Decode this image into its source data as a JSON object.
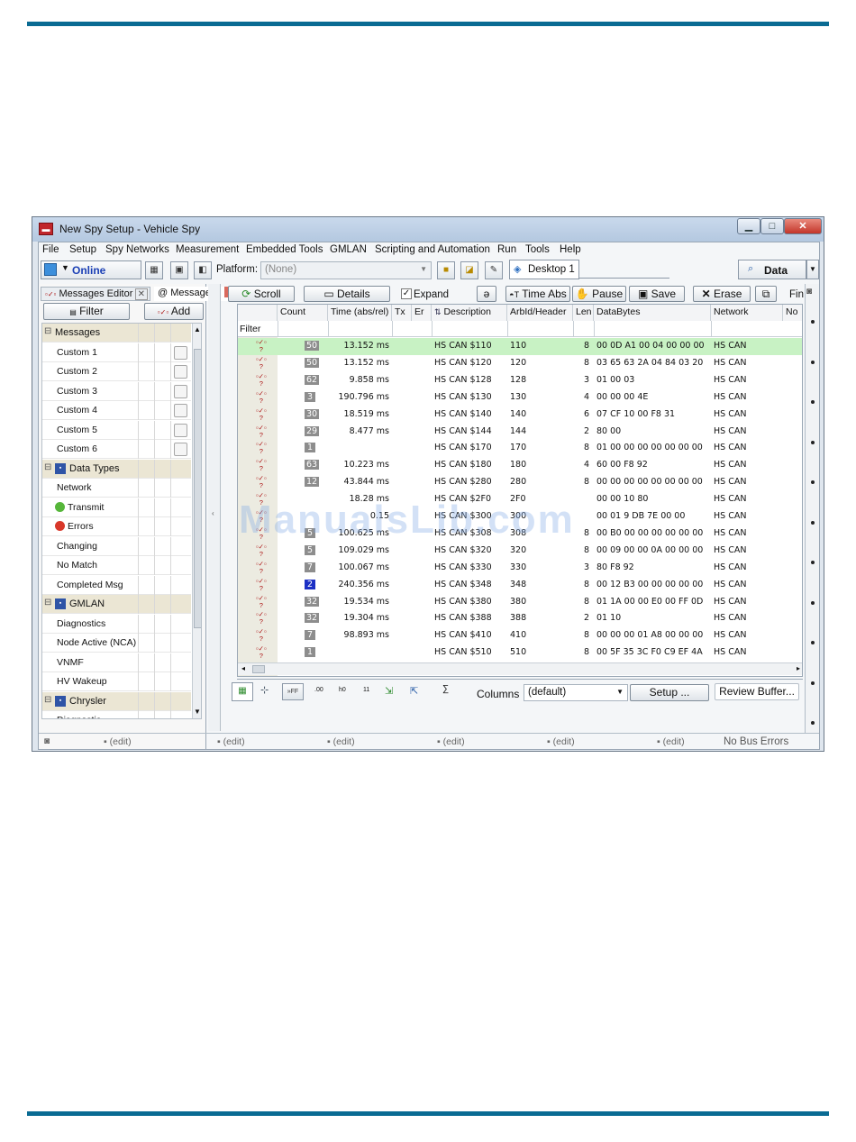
{
  "window": {
    "title": "New Spy Setup - Vehicle Spy"
  },
  "menu": [
    "File",
    "Setup",
    "Spy Networks",
    "Measurement",
    "Embedded Tools",
    "GMLAN",
    "Scripting and Automation",
    "Run",
    "Tools",
    "Help"
  ],
  "toolbar": {
    "status": "Online",
    "platform_label": "Platform:",
    "platform_value": "(None)",
    "desktop_tab": "Desktop 1",
    "data_button": "Data"
  },
  "left": {
    "tabs": [
      "Messages Editor",
      "Messages"
    ],
    "filter_button": "Filter",
    "add_button": "Add",
    "tree": [
      {
        "label": "Messages",
        "header": true
      },
      {
        "label": "Custom 1",
        "check": true
      },
      {
        "label": "Custom 2",
        "check": true
      },
      {
        "label": "Custom 3",
        "check": true
      },
      {
        "label": "Custom 4",
        "check": true
      },
      {
        "label": "Custom 5",
        "check": true
      },
      {
        "label": "Custom 6",
        "check": true
      },
      {
        "label": "Data Types",
        "header": true
      },
      {
        "label": "Network"
      },
      {
        "label": "Transmit",
        "icon": "green-circle-icon"
      },
      {
        "label": "Errors",
        "icon": "red-circle-icon"
      },
      {
        "label": "Changing"
      },
      {
        "label": "No Match"
      },
      {
        "label": "Completed Msg"
      },
      {
        "label": "GMLAN",
        "header": true
      },
      {
        "label": "Diagnostics"
      },
      {
        "label": "Node Active (NCA)"
      },
      {
        "label": "VNMF"
      },
      {
        "label": "HV Wakeup"
      },
      {
        "label": "Chrysler",
        "header": true
      },
      {
        "label": "Diagnostic"
      }
    ]
  },
  "main_toolbar": {
    "scroll": "Scroll",
    "details": "Details",
    "expand": "Expand",
    "time_abs": "Time Abs",
    "pause": "Pause",
    "save": "Save",
    "erase": "Erase",
    "find": "Fin"
  },
  "grid": {
    "headers": [
      "Count",
      "Time (abs/rel)",
      "Tx",
      "Er",
      "Description",
      "ArbId/Header",
      "Len",
      "DataBytes",
      "Network",
      "No"
    ],
    "filter_label": "Filter",
    "rows": [
      {
        "count": "50",
        "time": "13.152 ms",
        "desc": "HS CAN $110",
        "arb": "110",
        "len": "8",
        "data": "00 0D A1 00 04 00 00 00",
        "net": "HS CAN",
        "sel": true
      },
      {
        "count": "50",
        "time": "13.152 ms",
        "desc": "HS CAN $120",
        "arb": "120",
        "len": "8",
        "data": "03 65 63 2A 04 84 03 20",
        "net": "HS CAN"
      },
      {
        "count": "62",
        "time": "9.858 ms",
        "desc": "HS CAN $128",
        "arb": "128",
        "len": "3",
        "data": "01 00 03",
        "net": "HS CAN"
      },
      {
        "count": "3",
        "time": "190.796 ms",
        "desc": "HS CAN $130",
        "arb": "130",
        "len": "4",
        "data": "00 00 00 4E",
        "net": "HS CAN"
      },
      {
        "count": "30",
        "time": "18.519 ms",
        "desc": "HS CAN $140",
        "arb": "140",
        "len": "6",
        "data": "07 CF 10 00 F8 31",
        "net": "HS CAN"
      },
      {
        "count": "29",
        "time": "8.477 ms",
        "desc": "HS CAN $144",
        "arb": "144",
        "len": "2",
        "data": "80 00",
        "net": "HS CAN"
      },
      {
        "count": "1",
        "time": "",
        "desc": "HS CAN $170",
        "arb": "170",
        "len": "8",
        "data": "01 00 00 00 00 00 00 00",
        "net": "HS CAN"
      },
      {
        "count": "63",
        "time": "10.223 ms",
        "desc": "HS CAN $180",
        "arb": "180",
        "len": "4",
        "data": "60 00 F8 92",
        "net": "HS CAN"
      },
      {
        "count": "12",
        "time": "43.844 ms",
        "desc": "HS CAN $280",
        "arb": "280",
        "len": "8",
        "data": "00 00 00 00 00 00 00 00",
        "net": "HS CAN"
      },
      {
        "count": "",
        "time": "18.28 ms",
        "desc": "HS CAN $2F0",
        "arb": "2F0",
        "len": "",
        "data": "00 00 10 80",
        "net": "HS CAN"
      },
      {
        "count": "",
        "time": "0.15",
        "desc": "HS CAN $300",
        "arb": "300",
        "len": "",
        "data": "00 01 9 DB 7E 00 00",
        "net": "HS CAN"
      },
      {
        "count": "5",
        "time": "100.625 ms",
        "desc": "HS CAN $308",
        "arb": "308",
        "len": "8",
        "data": "00 B0 00 00 00 00 00 00",
        "net": "HS CAN"
      },
      {
        "count": "5",
        "time": "109.029 ms",
        "desc": "HS CAN $320",
        "arb": "320",
        "len": "8",
        "data": "00 09 00 00 0A 00 00 00",
        "net": "HS CAN"
      },
      {
        "count": "7",
        "time": "100.067 ms",
        "desc": "HS CAN $330",
        "arb": "330",
        "len": "3",
        "data": "80 F8 92",
        "net": "HS CAN"
      },
      {
        "count": "2",
        "time": "240.356 ms",
        "desc": "HS CAN $348",
        "arb": "348",
        "len": "8",
        "data": "00 12 B3 00 00 00 00 00",
        "net": "HS CAN",
        "blue": true
      },
      {
        "count": "32",
        "time": "19.534 ms",
        "desc": "HS CAN $380",
        "arb": "380",
        "len": "8",
        "data": "01 1A 00 00 E0 00 FF 0D",
        "net": "HS CAN"
      },
      {
        "count": "32",
        "time": "19.304 ms",
        "desc": "HS CAN $388",
        "arb": "388",
        "len": "2",
        "data": "01 10",
        "net": "HS CAN"
      },
      {
        "count": "7",
        "time": "98.893 ms",
        "desc": "HS CAN $410",
        "arb": "410",
        "len": "8",
        "data": "00 00 00 01 A8 00 00 00",
        "net": "HS CAN"
      },
      {
        "count": "1",
        "time": "",
        "desc": "HS CAN $510",
        "arb": "510",
        "len": "8",
        "data": "00 5F 35 3C F0 C9 EF 4A",
        "net": "HS CAN"
      }
    ]
  },
  "bottom": {
    "columns_label": "Columns",
    "columns_value": "(default)",
    "setup": "Setup ...",
    "review": "Review Buffer..."
  },
  "status": {
    "edits": [
      "(edit)",
      "(edit)",
      "(edit)",
      "(edit)",
      "(edit)",
      "(edit)"
    ],
    "bus": "No Bus Errors"
  },
  "watermark": "ManualsLib.com"
}
